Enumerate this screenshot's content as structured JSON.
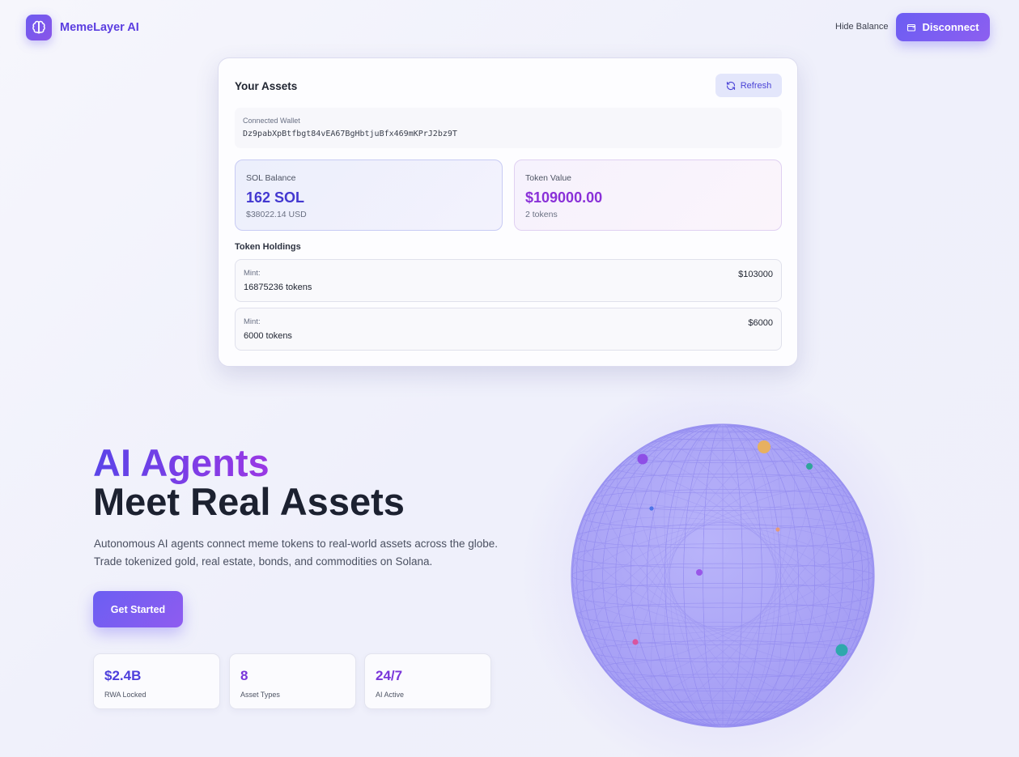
{
  "header": {
    "brand": "MemeLayer AI",
    "hide_balance": "Hide Balance",
    "disconnect": "Disconnect"
  },
  "assets": {
    "title": "Your Assets",
    "refresh": "Refresh",
    "wallet_label": "Connected Wallet",
    "wallet_address": "Dz9pabXpBtfbgt84vEA67BgHbtjuBfx469mKPrJ2bz9T",
    "sol": {
      "label": "SOL Balance",
      "value": "162 SOL",
      "usd": "$38022.14 USD"
    },
    "token": {
      "label": "Token Value",
      "value": "$109000.00",
      "count": "2 tokens"
    },
    "holdings_title": "Token Holdings",
    "holdings": [
      {
        "mint_label": "Mint:",
        "amount": "16875236 tokens",
        "usd": "$103000"
      },
      {
        "mint_label": "Mint:",
        "amount": "6000 tokens",
        "usd": "$6000"
      }
    ]
  },
  "hero": {
    "title_accent": "AI Agents",
    "title_main": "Meet Real Assets",
    "description": "Autonomous AI agents connect meme tokens to real-world assets across the globe. Trade tokenized gold, real estate, bonds, and commodities on Solana.",
    "cta": "Get Started",
    "stats": [
      {
        "value": "$2.4B",
        "label": "RWA Locked"
      },
      {
        "value": "8",
        "label": "Asset Types"
      },
      {
        "value": "24/7",
        "label": "AI Active"
      }
    ]
  },
  "colors": {
    "accent": "#6b5df3",
    "accent_secondary": "#8a31d8",
    "globe": "#a8a2f6"
  },
  "icons": {
    "logo": "brain-icon",
    "disconnect": "wallet-icon",
    "refresh": "refresh-icon"
  }
}
